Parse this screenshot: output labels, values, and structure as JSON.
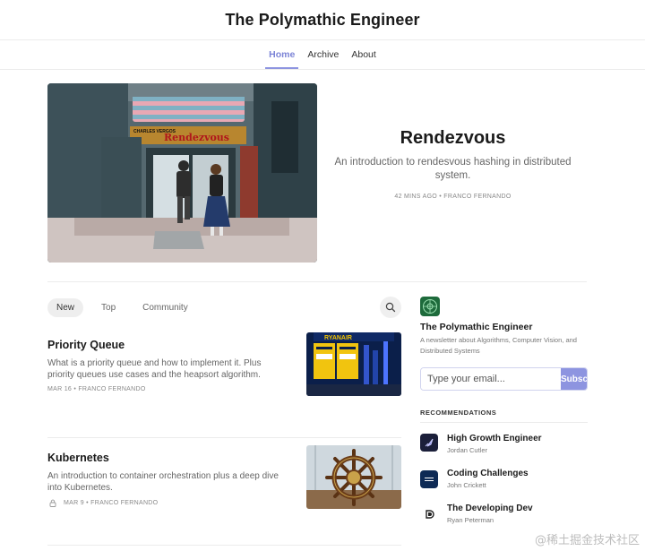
{
  "site": {
    "title": "The Polymathic Engineer"
  },
  "nav": {
    "items": [
      {
        "label": "Home"
      },
      {
        "label": "Archive"
      },
      {
        "label": "About"
      }
    ]
  },
  "hero": {
    "title": "Rendezvous",
    "subtitle": "An introduction to rendesvous hashing in distributed system.",
    "meta": "42 MINS AGO • FRANCO FERNANDO",
    "image_text": {
      "sign": "Rendezvous",
      "small_sign": "CHARLES VERGOS"
    }
  },
  "filters": {
    "tabs": [
      {
        "label": "New"
      },
      {
        "label": "Top"
      },
      {
        "label": "Community"
      }
    ],
    "search_icon": "search-icon"
  },
  "posts": [
    {
      "title": "Priority Queue",
      "description": "What is a priority queue and how to implement it. Plus priority queues use cases and the heapsort algorithm.",
      "meta": "MAR 16 • FRANCO FERNANDO",
      "thumb_text": "RYANAIR",
      "locked": false
    },
    {
      "title": "Kubernetes",
      "description": "An introduction to container orchestration plus a deep dive into Kubernetes.",
      "meta": "MAR 9 • FRANCO FERNANDO",
      "locked": true
    }
  ],
  "sidebar": {
    "publication": {
      "name": "The Polymathic Engineer",
      "description": "A newsletter about Algorithms, Computer Vision, and Distributed Systems"
    },
    "subscribe": {
      "placeholder": "Type your email...",
      "button": "Subscribe"
    },
    "recommendations_heading": "RECOMMENDATIONS",
    "recommendations": [
      {
        "name": "High Growth Engineer",
        "author": "Jordan Cutler"
      },
      {
        "name": "Coding Challenges",
        "author": "John Crickett"
      },
      {
        "name": "The Developing Dev",
        "author": "Ryan Peterman"
      }
    ]
  },
  "watermark": "@稀土掘金技术社区",
  "colors": {
    "accent": "#8d94e0",
    "pub_logo": "#1e6b3c"
  }
}
